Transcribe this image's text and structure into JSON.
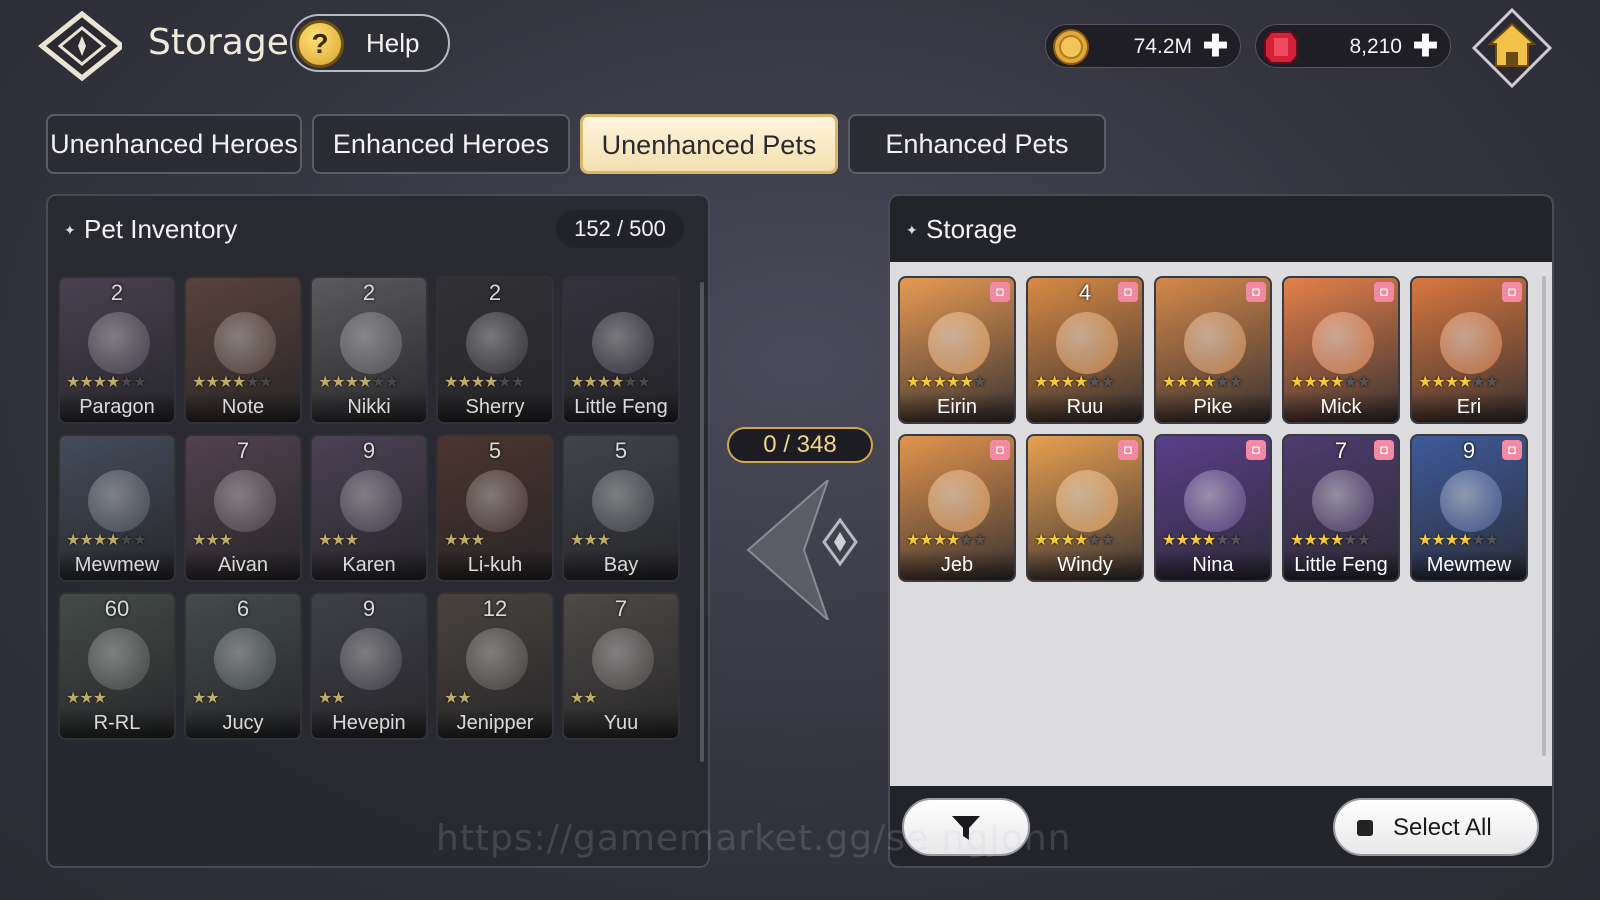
{
  "header": {
    "title": "Storage",
    "help_label": "Help",
    "help_icon": "?",
    "gold": "74.2M",
    "gems": "8,210",
    "plus": "✚"
  },
  "tabs": [
    {
      "label": "Unenhanced Heroes"
    },
    {
      "label": "Enhanced Heroes"
    },
    {
      "label": "Unenhanced Pets"
    },
    {
      "label": "Enhanced Pets"
    }
  ],
  "active_tab": "Unenhanced Pets",
  "inventory": {
    "title": "Pet Inventory",
    "count": "152 / 500",
    "pets": [
      {
        "name": "Paragon",
        "level": "2",
        "stars": 4,
        "max_stars": 6,
        "color": "#5a4a6a"
      },
      {
        "name": "Note",
        "level": "",
        "stars": 4,
        "max_stars": 6,
        "color": "#7a4a3a"
      },
      {
        "name": "Nikki",
        "level": "2",
        "stars": 4,
        "max_stars": 6,
        "color": "#6a6a72"
      },
      {
        "name": "Sherry",
        "level": "2",
        "stars": 4,
        "max_stars": 6,
        "color": "#3a3a44"
      },
      {
        "name": "Little Feng",
        "level": "",
        "stars": 4,
        "max_stars": 6,
        "color": "#3e3a52"
      },
      {
        "name": "Mewmew",
        "level": "",
        "stars": 4,
        "max_stars": 6,
        "color": "#4a5a78"
      },
      {
        "name": "Aivan",
        "level": "7",
        "stars": 3,
        "max_stars": 3,
        "color": "#6a4a62"
      },
      {
        "name": "Karen",
        "level": "9",
        "stars": 3,
        "max_stars": 3,
        "color": "#5e4a72"
      },
      {
        "name": "Li-kuh",
        "level": "5",
        "stars": 3,
        "max_stars": 3,
        "color": "#6a3a2e"
      },
      {
        "name": "Bay",
        "level": "5",
        "stars": 3,
        "max_stars": 3,
        "color": "#4a5060"
      },
      {
        "name": "R-RL",
        "level": "60",
        "stars": 3,
        "max_stars": 3,
        "color": "#4a5a52"
      },
      {
        "name": "Jucy",
        "level": "6",
        "stars": 2,
        "max_stars": 2,
        "color": "#4a5a5a"
      },
      {
        "name": "Hevepin",
        "level": "9",
        "stars": 2,
        "max_stars": 2,
        "color": "#4a4a5e"
      },
      {
        "name": "Jenipper",
        "level": "12",
        "stars": 2,
        "max_stars": 2,
        "color": "#5a4e44"
      },
      {
        "name": "Yuu",
        "level": "7",
        "stars": 2,
        "max_stars": 2,
        "color": "#5e5650"
      }
    ]
  },
  "transfer_count": "0 / 348",
  "storage": {
    "title": "Storage",
    "pets": [
      {
        "name": "Eirin",
        "level": "",
        "stars": 5,
        "max_stars": 6,
        "color": "#e79a52"
      },
      {
        "name": "Ruu",
        "level": "4",
        "stars": 4,
        "max_stars": 6,
        "color": "#d88a44"
      },
      {
        "name": "Pike",
        "level": "",
        "stars": 4,
        "max_stars": 6,
        "color": "#d4884a"
      },
      {
        "name": "Mick",
        "level": "",
        "stars": 4,
        "max_stars": 6,
        "color": "#e4804a"
      },
      {
        "name": "Eri",
        "level": "",
        "stars": 4,
        "max_stars": 6,
        "color": "#d8783e"
      },
      {
        "name": "Jeb",
        "level": "",
        "stars": 4,
        "max_stars": 6,
        "color": "#e2944c"
      },
      {
        "name": "Windy",
        "level": "",
        "stars": 4,
        "max_stars": 6,
        "color": "#e8a050"
      },
      {
        "name": "Nina",
        "level": "",
        "stars": 4,
        "max_stars": 6,
        "color": "#5a3e8a"
      },
      {
        "name": "Little Feng",
        "level": "7",
        "stars": 4,
        "max_stars": 6,
        "color": "#4e3c6e"
      },
      {
        "name": "Mewmew",
        "level": "9",
        "stars": 4,
        "max_stars": 6,
        "color": "#3e5a9a"
      }
    ]
  },
  "footer": {
    "select_all": "Select All"
  },
  "watermark": "https://gamemarket.gg/se    ngJohn",
  "colors": {
    "accent_gold": "#d2a94a",
    "star": "#f6c937",
    "tab_active_bg": "#f3dfb0"
  }
}
